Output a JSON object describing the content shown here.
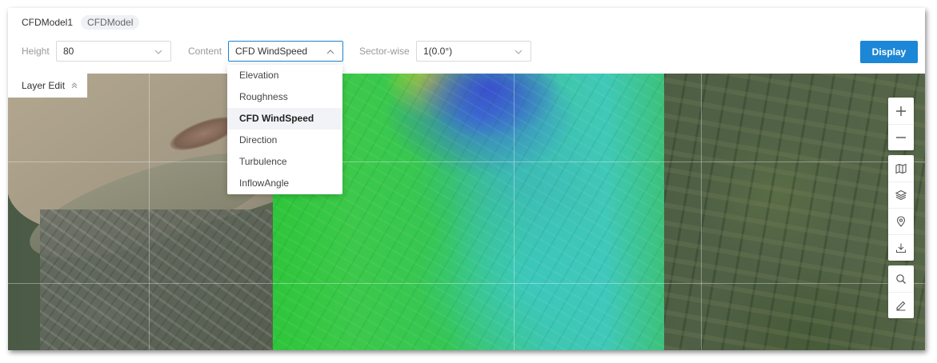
{
  "header": {
    "model_title": "CFDModel1",
    "model_tag": "CFDModel"
  },
  "controls": {
    "height_label": "Height",
    "height_value": "80",
    "content_label": "Content",
    "content_value": "CFD WindSpeed",
    "sector_label": "Sector-wise",
    "sector_value": "1(0.0°)",
    "display_label": "Display"
  },
  "content_dropdown": {
    "open": true,
    "options": [
      "Elevation",
      "Roughness",
      "CFD WindSpeed",
      "Direction",
      "Turbulence",
      "InflowAngle"
    ],
    "selected": "CFD WindSpeed"
  },
  "map": {
    "layer_edit_label": "Layer Edit",
    "tools": [
      "zoom-in-icon",
      "zoom-out-icon",
      "map-icon",
      "layers-icon",
      "location-pin-icon",
      "download-icon",
      "search-icon",
      "edit-icon"
    ]
  },
  "colors": {
    "accent": "#1c87d6",
    "selected_bg": "#f2f3f6"
  }
}
